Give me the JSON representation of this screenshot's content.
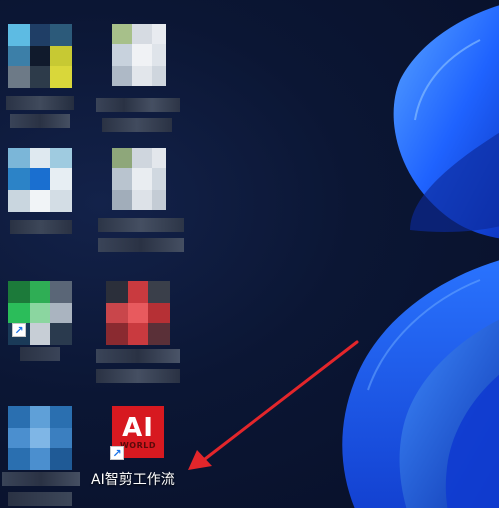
{
  "desktop": {
    "icons": [
      {
        "name": "blurred-app-1",
        "label": ""
      },
      {
        "name": "blurred-file-1",
        "label": ""
      },
      {
        "name": "blurred-app-2",
        "label": ""
      },
      {
        "name": "blurred-file-2",
        "label": ""
      },
      {
        "name": "blurred-app-3",
        "label": ""
      },
      {
        "name": "blurred-app-4",
        "label": ""
      },
      {
        "name": "blurred-app-5",
        "label": ""
      },
      {
        "name": "ai-workflow-shortcut",
        "label": "AI智剪工作流",
        "logo_text": "AI",
        "logo_subtext": "WORLD",
        "icon_type": "shortcut",
        "accent": "#d71920"
      }
    ]
  },
  "annotation": {
    "type": "arrow",
    "color": "#e3262b"
  },
  "colors": {
    "background": "#0a1330",
    "wallpaper_accent": "#1f63ff"
  }
}
